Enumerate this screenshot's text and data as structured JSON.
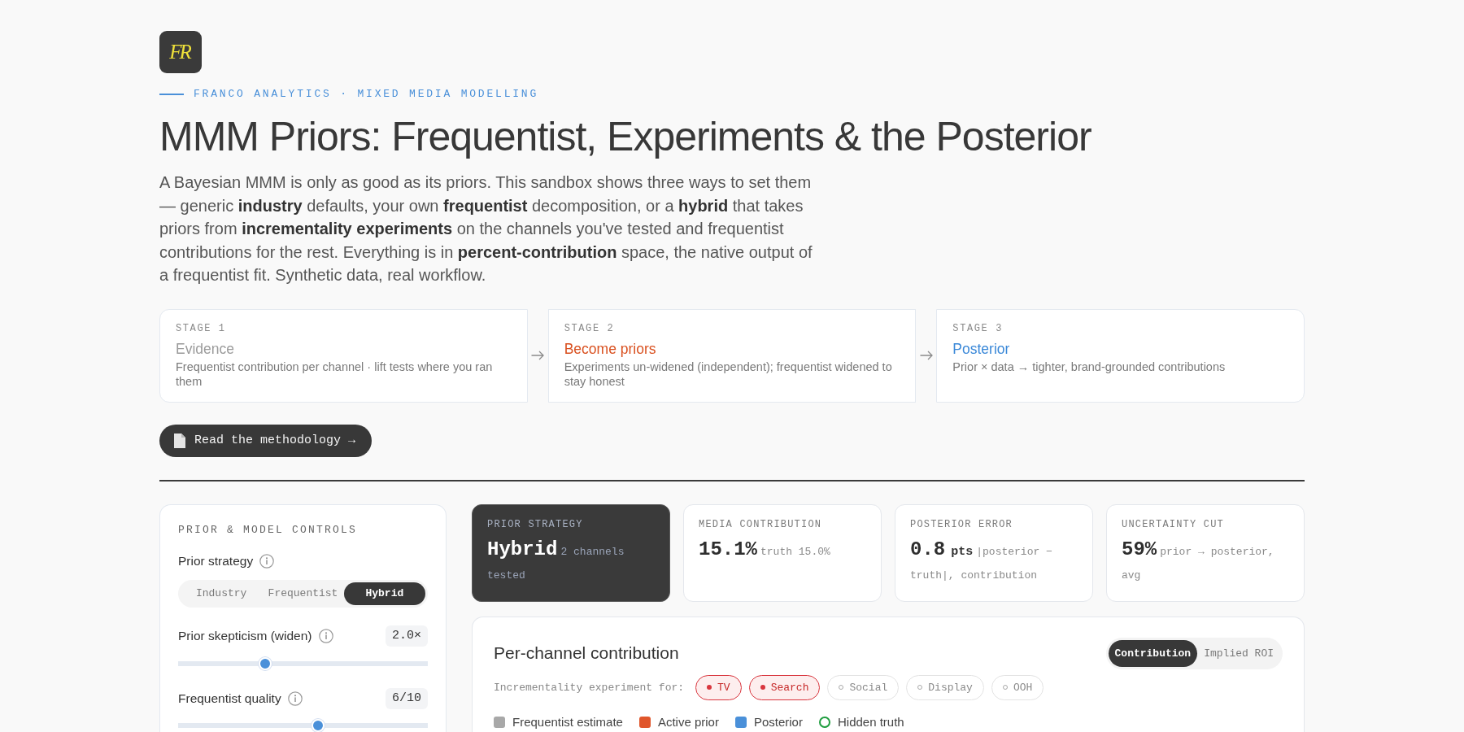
{
  "logo": {
    "text": "FR"
  },
  "eyebrow": "FRANCO ANALYTICS · MIXED MEDIA MODELLING",
  "title": "MMM Priors: Frequentist, Experiments & the Posterior",
  "intro": "A Bayesian MMM is only as good as its priors. This sandbox shows three ways to set them — generic **industry** defaults, your own **frequentist** decomposition, or a **hybrid** that takes priors from **incrementality experiments** on the channels you've tested and frequentist contributions for the rest. Everything is in **percent-contribution** space, the native output of a frequentist fit. Synthetic data, real workflow.",
  "stages": [
    {
      "label": "STAGE 1",
      "title": "Evidence",
      "color": "#9b9b9b",
      "description": "Frequentist contribution per channel · lift tests where you ran them"
    },
    {
      "label": "STAGE 2",
      "title": "Become priors",
      "color": "#d9501f",
      "description": "Experiments un-widened (independent); frequentist widened to stay honest"
    },
    {
      "label": "STAGE 3",
      "title": "Posterior",
      "color": "#3a88d8",
      "description": "Prior × data → tighter, brand-grounded contributions"
    }
  ],
  "methodology_button": {
    "label": "Read the methodology →"
  },
  "controls": {
    "heading": "PRIOR & MODEL CONTROLS",
    "strategy": {
      "label": "Prior strategy",
      "options": [
        {
          "label": "Industry",
          "selected": false
        },
        {
          "label": "Frequentist",
          "selected": false
        },
        {
          "label": "Hybrid",
          "selected": true
        }
      ]
    },
    "sliders": [
      {
        "label": "Prior skepticism (widen)",
        "value": "2.0×",
        "level": 0.35
      },
      {
        "label": "Frequentist quality",
        "value": "6/10",
        "level": 0.56
      }
    ]
  },
  "stats": [
    {
      "label": "PRIOR STRATEGY",
      "value": "Hybrid",
      "note": "2 channels tested",
      "highlighted": true
    },
    {
      "label": "MEDIA CONTRIBUTION",
      "value": "15.1%",
      "note": "truth 15.0%",
      "highlighted": false
    },
    {
      "label": "POSTERIOR ERROR",
      "value": "0.8",
      "unit": "pts",
      "note": "|posterior − truth|, contribution",
      "highlighted": false
    },
    {
      "label": "UNCERTAINTY CUT",
      "value": "59%",
      "note": "prior → posterior, avg",
      "highlighted": false
    }
  ],
  "contribution": {
    "title": "Per-channel contribution",
    "view_toggle": [
      {
        "label": "Contribution",
        "selected": true
      },
      {
        "label": "Implied ROI",
        "selected": false
      }
    ],
    "experiment_label": "Incrementality experiment for:",
    "channels": [
      {
        "label": "TV",
        "selected": true
      },
      {
        "label": "Search",
        "selected": true
      },
      {
        "label": "Social",
        "selected": false
      },
      {
        "label": "Display",
        "selected": false
      },
      {
        "label": "OOH",
        "selected": false
      }
    ],
    "legend": [
      {
        "label": "Frequentist estimate",
        "kind": "square",
        "color": "#a8a8a8"
      },
      {
        "label": "Active prior",
        "kind": "square",
        "color": "#e0562b"
      },
      {
        "label": "Posterior",
        "kind": "square",
        "color": "#4a90d9"
      },
      {
        "label": "Hidden truth",
        "kind": "ring",
        "color": "#1f9d3f"
      }
    ]
  }
}
